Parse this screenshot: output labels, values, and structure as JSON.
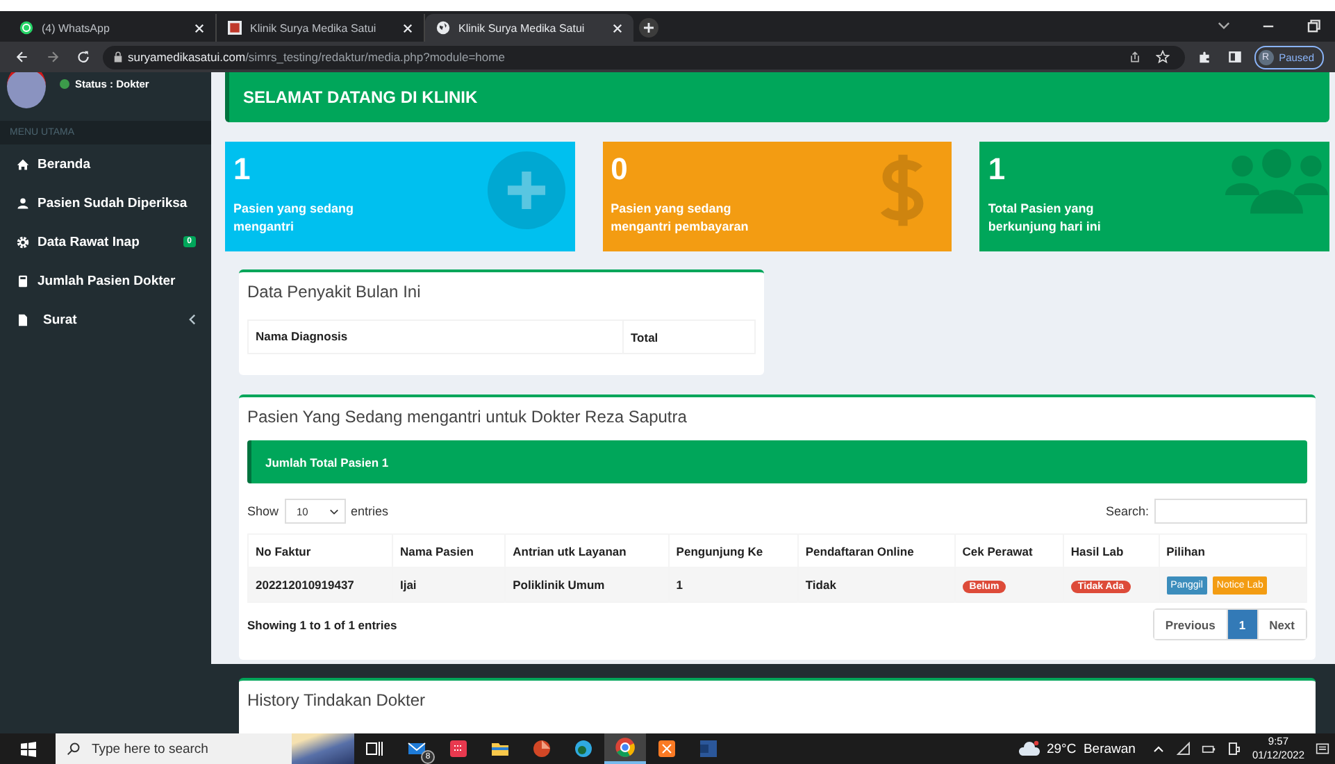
{
  "browser": {
    "tabs": [
      {
        "title": "(4) WhatsApp",
        "kind": "chat",
        "selected": false
      },
      {
        "title": "Klinik Surya Medika Satui",
        "kind": "picture",
        "selected": false
      },
      {
        "title": "Klinik Surya Medika Satui",
        "kind": "globe",
        "selected": true
      }
    ],
    "url_host": "suryamedikasatui.com",
    "url_path": "/simrs_testing/redaktur/media.php?module=home",
    "profile_initial": "R",
    "profile_status": "Paused"
  },
  "sidebar": {
    "status": "Status : Dokter",
    "section": "MENU UTAMA",
    "items": [
      {
        "label": "Beranda",
        "kind": "home"
      },
      {
        "label": "Pasien Sudah Diperiksa",
        "kind": "user"
      },
      {
        "label": "Data Rawat Inap",
        "kind": "gear",
        "badge": "0"
      },
      {
        "label": "Jumlah Pasien Dokter",
        "kind": "calculator"
      },
      {
        "label": "Surat",
        "kind": "file",
        "submenu": true
      }
    ]
  },
  "banner": "SELAMAT DATANG DI KLINIK",
  "info_boxes": [
    {
      "value": "1",
      "label": "Pasien yang sedang mengantri",
      "color": "#00c0ef",
      "kind": "plus"
    },
    {
      "value": "0",
      "label": "Pasien yang sedang mengantri pembayaran",
      "color": "#f39c12",
      "kind": "dollar"
    },
    {
      "value": "1",
      "label": "Total Pasien yang berkunjung hari ini",
      "color": "#00a65a",
      "kind": "users"
    }
  ],
  "disease_box": {
    "title": "Data Penyakit Bulan Ini",
    "columns": [
      "Nama Diagnosis",
      "Total"
    ]
  },
  "queue_box": {
    "title": "Pasien Yang Sedang mengantri untuk Dokter Reza Saputra",
    "callout": "Jumlah Total Pasien 1",
    "show_label": "Show",
    "page_size": "10",
    "entries_label": "entries",
    "search_label": "Search:",
    "columns": [
      "No Faktur",
      "Nama Pasien",
      "Antrian utk Layanan",
      "Pengunjung Ke",
      "Pendaftaran Online",
      "Cek Perawat",
      "Hasil Lab",
      "Pilihan"
    ],
    "rows": [
      {
        "cells": [
          {
            "kind": "text",
            "text": "202212010919437"
          },
          {
            "kind": "text",
            "text": "Ijai"
          },
          {
            "kind": "text",
            "text": "Poliklinik Umum"
          },
          {
            "kind": "text",
            "text": "1"
          },
          {
            "kind": "text",
            "text": "Tidak"
          },
          {
            "kind": "label",
            "text": "Belum",
            "color": "#dd4b39"
          },
          {
            "kind": "label",
            "text": "Tidak Ada",
            "color": "#dd4b39"
          },
          {
            "kind": "actions",
            "buttons": [
              {
                "label": "Panggil",
                "color": "#3c8dbc"
              },
              {
                "label": "Notice Lab",
                "color": "#f39c12"
              }
            ]
          }
        ]
      }
    ],
    "info": "Showing 1 to 1 of 1 entries",
    "pages": [
      {
        "label": "Previous",
        "selected": false
      },
      {
        "label": "1",
        "selected": true
      },
      {
        "label": "Next",
        "selected": false
      }
    ]
  },
  "history_box": {
    "title": "History Tindakan Dokter"
  },
  "taskbar": {
    "search_placeholder": "Type here to search",
    "mail_badge": "8",
    "weather": "29°C  Berawan",
    "time": "9:57",
    "date": "01/12/2022"
  }
}
